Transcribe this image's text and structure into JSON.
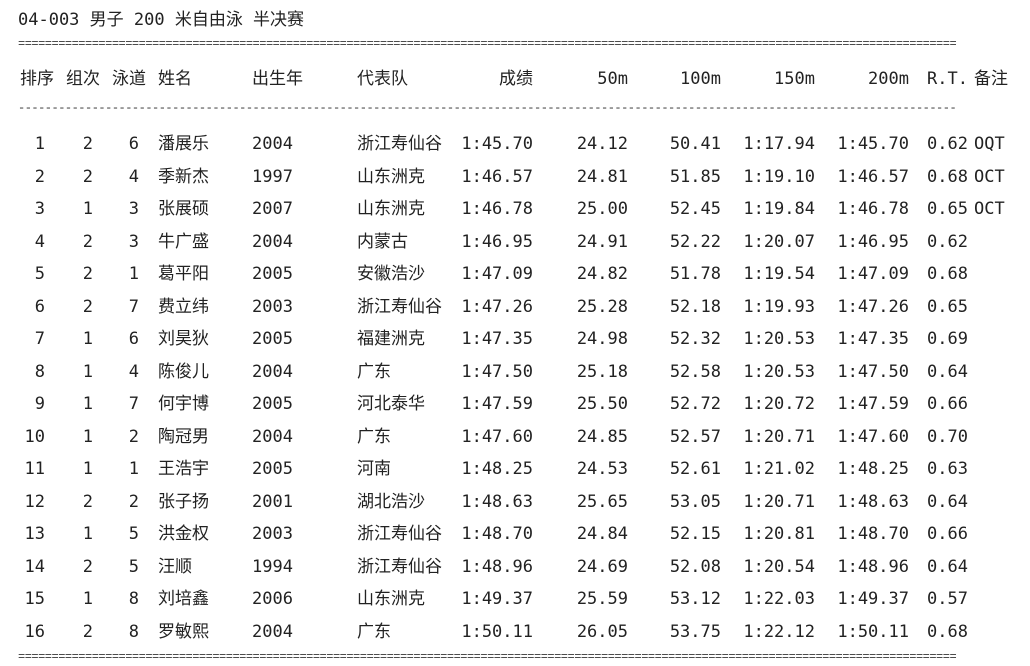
{
  "title": "04-003 男子 200 米自由泳 半决赛",
  "separator_double": "============================================================================================================================================",
  "separator_single": "--------------------------------------------------------------------------------------------------------------------------------------------",
  "headers": {
    "rank": "排序",
    "group": "组次",
    "lane": "泳道",
    "name": "姓名",
    "birth": "出生年",
    "team": "代表队",
    "result": "成绩",
    "s50": "50m",
    "s100": "100m",
    "s150": "150m",
    "s200": "200m",
    "rt": "R.T.",
    "note": "备注"
  },
  "rows": [
    {
      "rank": "1",
      "group": "2",
      "lane": "6",
      "name": "潘展乐",
      "birth": "2004",
      "team": "浙江寿仙谷",
      "result": "1:45.70",
      "s50": "24.12",
      "s100": "50.41",
      "s150": "1:17.94",
      "s200": "1:45.70",
      "rt": "0.62",
      "note": "OQT"
    },
    {
      "rank": "2",
      "group": "2",
      "lane": "4",
      "name": "季新杰",
      "birth": "1997",
      "team": "山东洲克",
      "result": "1:46.57",
      "s50": "24.81",
      "s100": "51.85",
      "s150": "1:19.10",
      "s200": "1:46.57",
      "rt": "0.68",
      "note": "OCT"
    },
    {
      "rank": "3",
      "group": "1",
      "lane": "3",
      "name": "张展硕",
      "birth": "2007",
      "team": "山东洲克",
      "result": "1:46.78",
      "s50": "25.00",
      "s100": "52.45",
      "s150": "1:19.84",
      "s200": "1:46.78",
      "rt": "0.65",
      "note": "OCT"
    },
    {
      "rank": "4",
      "group": "2",
      "lane": "3",
      "name": "牛广盛",
      "birth": "2004",
      "team": "内蒙古",
      "result": "1:46.95",
      "s50": "24.91",
      "s100": "52.22",
      "s150": "1:20.07",
      "s200": "1:46.95",
      "rt": "0.62",
      "note": ""
    },
    {
      "rank": "5",
      "group": "2",
      "lane": "1",
      "name": "葛平阳",
      "birth": "2005",
      "team": "安徽浩沙",
      "result": "1:47.09",
      "s50": "24.82",
      "s100": "51.78",
      "s150": "1:19.54",
      "s200": "1:47.09",
      "rt": "0.68",
      "note": ""
    },
    {
      "rank": "6",
      "group": "2",
      "lane": "7",
      "name": "费立纬",
      "birth": "2003",
      "team": "浙江寿仙谷",
      "result": "1:47.26",
      "s50": "25.28",
      "s100": "52.18",
      "s150": "1:19.93",
      "s200": "1:47.26",
      "rt": "0.65",
      "note": ""
    },
    {
      "rank": "7",
      "group": "1",
      "lane": "6",
      "name": "刘昊狄",
      "birth": "2005",
      "team": "福建洲克",
      "result": "1:47.35",
      "s50": "24.98",
      "s100": "52.32",
      "s150": "1:20.53",
      "s200": "1:47.35",
      "rt": "0.69",
      "note": ""
    },
    {
      "rank": "8",
      "group": "1",
      "lane": "4",
      "name": "陈俊儿",
      "birth": "2004",
      "team": "广东",
      "result": "1:47.50",
      "s50": "25.18",
      "s100": "52.58",
      "s150": "1:20.53",
      "s200": "1:47.50",
      "rt": "0.64",
      "note": ""
    },
    {
      "rank": "9",
      "group": "1",
      "lane": "7",
      "name": "何宇博",
      "birth": "2005",
      "team": "河北泰华",
      "result": "1:47.59",
      "s50": "25.50",
      "s100": "52.72",
      "s150": "1:20.72",
      "s200": "1:47.59",
      "rt": "0.66",
      "note": ""
    },
    {
      "rank": "10",
      "group": "1",
      "lane": "2",
      "name": "陶冠男",
      "birth": "2004",
      "team": "广东",
      "result": "1:47.60",
      "s50": "24.85",
      "s100": "52.57",
      "s150": "1:20.71",
      "s200": "1:47.60",
      "rt": "0.70",
      "note": ""
    },
    {
      "rank": "11",
      "group": "1",
      "lane": "1",
      "name": "王浩宇",
      "birth": "2005",
      "team": "河南",
      "result": "1:48.25",
      "s50": "24.53",
      "s100": "52.61",
      "s150": "1:21.02",
      "s200": "1:48.25",
      "rt": "0.63",
      "note": ""
    },
    {
      "rank": "12",
      "group": "2",
      "lane": "2",
      "name": "张子扬",
      "birth": "2001",
      "team": "湖北浩沙",
      "result": "1:48.63",
      "s50": "25.65",
      "s100": "53.05",
      "s150": "1:20.71",
      "s200": "1:48.63",
      "rt": "0.64",
      "note": ""
    },
    {
      "rank": "13",
      "group": "1",
      "lane": "5",
      "name": "洪金权",
      "birth": "2003",
      "team": "浙江寿仙谷",
      "result": "1:48.70",
      "s50": "24.84",
      "s100": "52.15",
      "s150": "1:20.81",
      "s200": "1:48.70",
      "rt": "0.66",
      "note": ""
    },
    {
      "rank": "14",
      "group": "2",
      "lane": "5",
      "name": "汪顺",
      "birth": "1994",
      "team": "浙江寿仙谷",
      "result": "1:48.96",
      "s50": "24.69",
      "s100": "52.08",
      "s150": "1:20.54",
      "s200": "1:48.96",
      "rt": "0.64",
      "note": ""
    },
    {
      "rank": "15",
      "group": "1",
      "lane": "8",
      "name": "刘培鑫",
      "birth": "2006",
      "team": "山东洲克",
      "result": "1:49.37",
      "s50": "25.59",
      "s100": "53.12",
      "s150": "1:22.03",
      "s200": "1:49.37",
      "rt": "0.57",
      "note": ""
    },
    {
      "rank": "16",
      "group": "2",
      "lane": "8",
      "name": "罗敏熙",
      "birth": "2004",
      "team": "广东",
      "result": "1:50.11",
      "s50": "26.05",
      "s100": "53.75",
      "s150": "1:22.12",
      "s200": "1:50.11",
      "rt": "0.68",
      "note": ""
    }
  ]
}
